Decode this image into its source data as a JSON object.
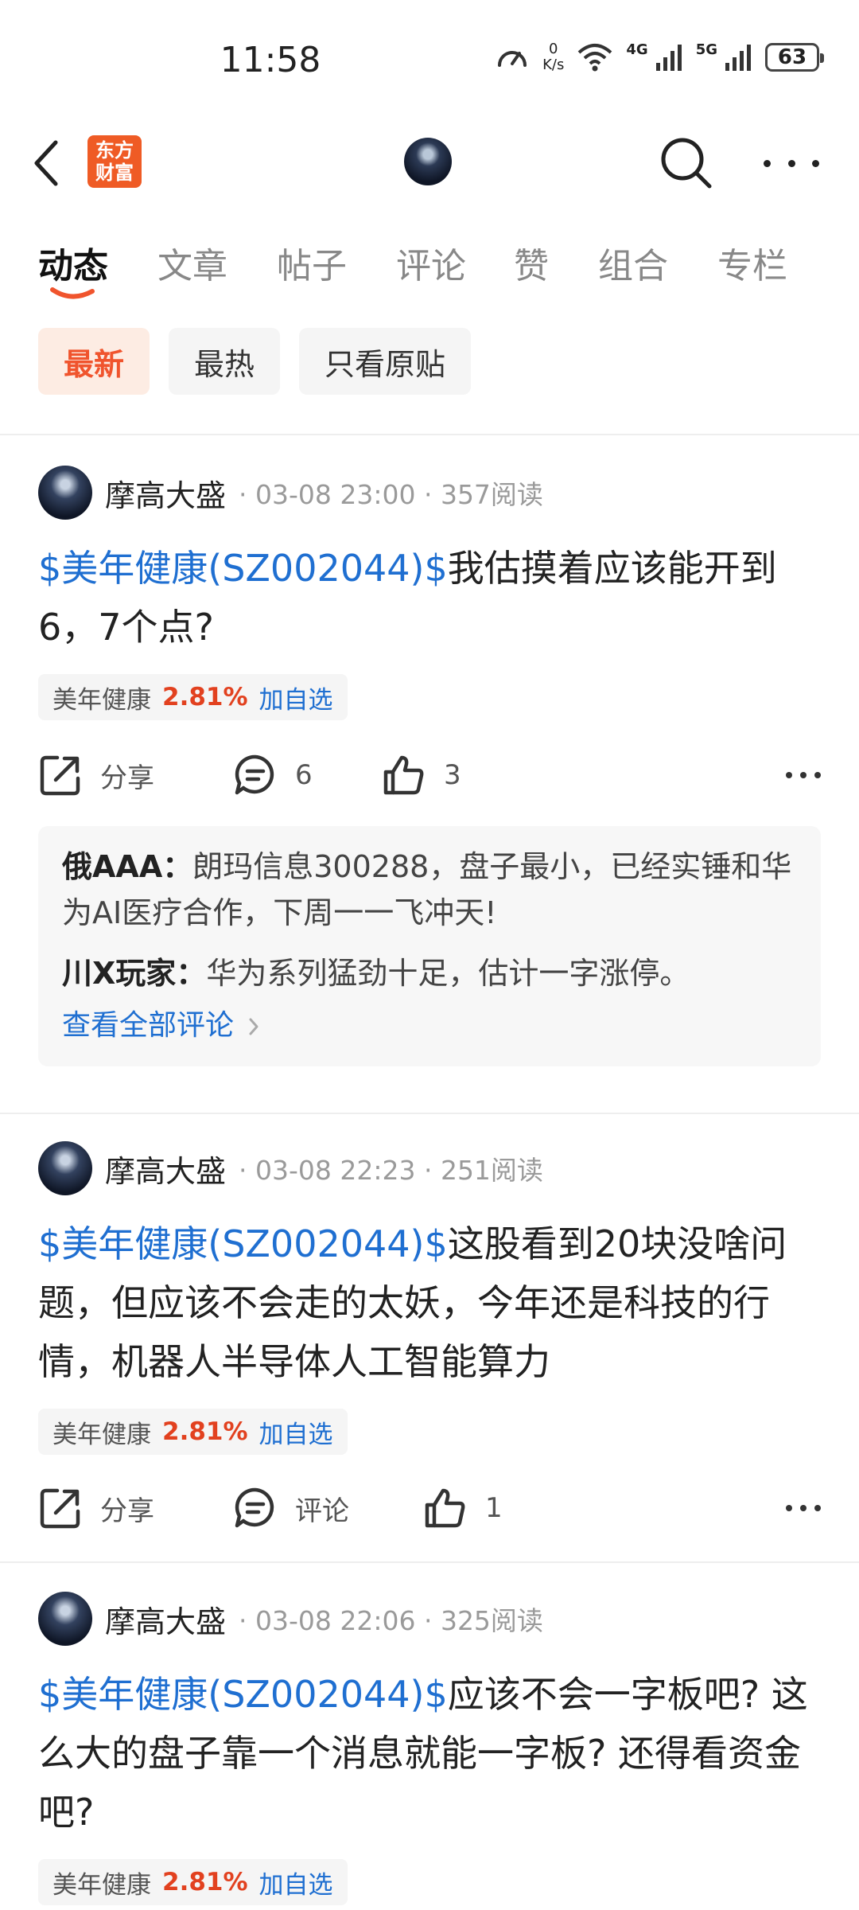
{
  "status_bar": {
    "time": "11:58",
    "net_speed_value": "0",
    "net_speed_unit": "K/s",
    "signal_1_label": "4G",
    "signal_2_label": "5G",
    "battery": "63"
  },
  "header": {
    "logo_line1": "东方",
    "logo_line2": "财富",
    "icons": [
      "back-arrow-icon",
      "user-avatar",
      "search-icon",
      "more-icon"
    ]
  },
  "tabs": [
    {
      "label": "动态",
      "active": true
    },
    {
      "label": "文章",
      "active": false
    },
    {
      "label": "帖子",
      "active": false
    },
    {
      "label": "评论",
      "active": false
    },
    {
      "label": "赞",
      "active": false
    },
    {
      "label": "组合",
      "active": false
    },
    {
      "label": "专栏",
      "active": false
    }
  ],
  "accent_color": "#f0542d",
  "link_color": "#1f6fd1",
  "filters": [
    {
      "label": "最新",
      "active": true
    },
    {
      "label": "最热",
      "active": false
    },
    {
      "label": "只看原贴",
      "active": false
    }
  ],
  "posts": [
    {
      "author": "摩高大盛",
      "meta": "· 03-08 23:00 · 357阅读",
      "stock_tag": "$美年健康(SZ002044)$",
      "text": "我估摸着应该能开到6，7个点?",
      "quote": {
        "name": "美年健康",
        "change": "2.81%",
        "add_label": "加自选"
      },
      "actions": {
        "share": "分享",
        "comment": "6",
        "like": "3"
      },
      "comments": [
        {
          "user": "俄AAA：",
          "text": "朗玛信息300288，盘子最小，已经实锤和华为AI医疗合作，下周一一飞冲天!"
        },
        {
          "user": "川X玩家：",
          "text": "华为系列猛劲十足，估计一字涨停。"
        }
      ],
      "view_all": "查看全部评论"
    },
    {
      "author": "摩高大盛",
      "meta": "· 03-08 22:23 · 251阅读",
      "stock_tag": "$美年健康(SZ002044)$",
      "text": "这股看到20块没啥问题，但应该不会走的太妖，今年还是科技的行情，机器人半导体人工智能算力",
      "quote": {
        "name": "美年健康",
        "change": "2.81%",
        "add_label": "加自选"
      },
      "actions": {
        "share": "分享",
        "comment": "评论",
        "like": "1"
      }
    },
    {
      "author": "摩高大盛",
      "meta": "· 03-08 22:06 · 325阅读",
      "stock_tag": "$美年健康(SZ002044)$",
      "text": "应该不会一字板吧? 这么大的盘子靠一个消息就能一字板? 还得看资金吧?",
      "quote": {
        "name": "美年健康",
        "change": "2.81%",
        "add_label": "加自选"
      }
    }
  ]
}
